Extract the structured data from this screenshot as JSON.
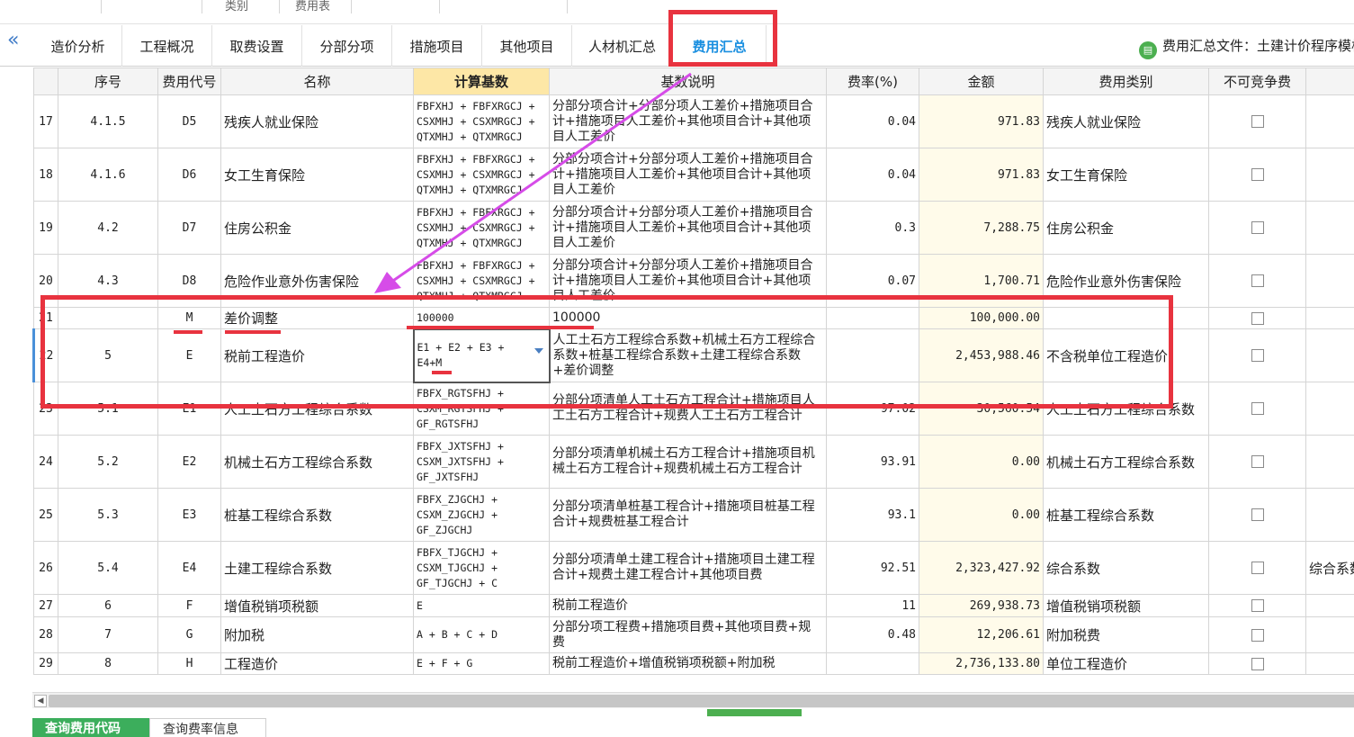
{
  "top_strip": {
    "labels": [
      "类别",
      "费用表"
    ]
  },
  "tabs": [
    {
      "label": "造价分析"
    },
    {
      "label": "工程概况"
    },
    {
      "label": "取费设置"
    },
    {
      "label": "分部分项"
    },
    {
      "label": "措施项目"
    },
    {
      "label": "其他项目"
    },
    {
      "label": "人材机汇总"
    },
    {
      "label": "费用汇总"
    }
  ],
  "active_tab": "费用汇总",
  "file_info": "费用汇总文件：土建计价程序模板",
  "columns": [
    "",
    "序号",
    "费用代号",
    "名称",
    "计算基数",
    "基数说明",
    "费率(%)",
    "金额",
    "费用类别",
    "不可竞争费",
    ""
  ],
  "rows": [
    {
      "idx": "17",
      "seq": "4.1.5",
      "code": "D5",
      "name": "残疾人就业保险",
      "formula": "FBFXHJ + FBFXRGCJ +\nCSXMHJ + CSXMRGCJ +\nQTXMHJ + QTXMRGCJ",
      "desc": "分部分项合计+分部分项人工差价+措施项目合计+措施项目人工差价+其他项目合计+其他项目人工差价",
      "rate": "0.04",
      "amount": "971.83",
      "category": "残疾人就业保险",
      "extra": ""
    },
    {
      "idx": "18",
      "seq": "4.1.6",
      "code": "D6",
      "name": "女工生育保险",
      "formula": "FBFXHJ + FBFXRGCJ +\nCSXMHJ + CSXMRGCJ +\nQTXMHJ + QTXMRGCJ",
      "desc": "分部分项合计+分部分项人工差价+措施项目合计+措施项目人工差价+其他项目合计+其他项目人工差价",
      "rate": "0.04",
      "amount": "971.83",
      "category": "女工生育保险",
      "extra": ""
    },
    {
      "idx": "19",
      "seq": "4.2",
      "code": "D7",
      "name": "住房公积金",
      "formula": "FBFXHJ + FBFXRGCJ +\nCSXMHJ + CSXMRGCJ +\nQTXMHJ + QTXMRGCJ",
      "desc": "分部分项合计+分部分项人工差价+措施项目合计+措施项目人工差价+其他项目合计+其他项目人工差价",
      "rate": "0.3",
      "amount": "7,288.75",
      "category": "住房公积金",
      "extra": ""
    },
    {
      "idx": "20",
      "seq": "4.3",
      "code": "D8",
      "name": "危险作业意外伤害保险",
      "formula": "FBFXHJ + FBFXRGCJ +\nCSXMHJ + CSXMRGCJ +\nQTXMHJ + QTXMRGCJ",
      "desc": "分部分项合计+分部分项人工差价+措施项目合计+措施项目人工差价+其他项目合计+其他项目人工差价",
      "rate": "0.07",
      "amount": "1,700.71",
      "category": "危险作业意外伤害保险",
      "extra": ""
    },
    {
      "idx": "21",
      "seq": "",
      "code": "M",
      "name": "差价调整",
      "formula": "100000",
      "desc": "100000",
      "rate": "",
      "amount": "100,000.00",
      "category": "",
      "extra": ""
    },
    {
      "idx": "22",
      "seq": "5",
      "code": "E",
      "name": "税前工程造价",
      "formula": "E1 + E2 + E3 +\nE4+M",
      "desc": "人工土石方工程综合系数+机械土石方工程综合系数+桩基工程综合系数+土建工程综合系数+差价调整",
      "rate": "",
      "amount": "2,453,988.46",
      "category": "不含税单位工程造价",
      "extra": ""
    },
    {
      "idx": "23",
      "seq": "5.1",
      "code": "E1",
      "name": "人工土石方工程综合系数",
      "formula": "FBFX_RGTSFHJ +\nCSXM_RGTSFHJ +\nGF_RGTSFHJ",
      "desc": "分部分项清单人工土石方工程合计+措施项目人工土石方工程合计+规费人工土石方工程合计",
      "rate": "97.02",
      "amount": "30,560.54",
      "category": "人工土石方工程综合系数",
      "extra": ""
    },
    {
      "idx": "24",
      "seq": "5.2",
      "code": "E2",
      "name": "机械土石方工程综合系数",
      "formula": "FBFX_JXTSFHJ +\nCSXM_JXTSFHJ +\nGF_JXTSFHJ",
      "desc": "分部分项清单机械土石方工程合计+措施项目机械土石方工程合计+规费机械土石方工程合计",
      "rate": "93.91",
      "amount": "0.00",
      "category": "机械土石方工程综合系数",
      "extra": ""
    },
    {
      "idx": "25",
      "seq": "5.3",
      "code": "E3",
      "name": "桩基工程综合系数",
      "formula": "FBFX_ZJGCHJ +\nCSXM_ZJGCHJ +\nGF_ZJGCHJ",
      "desc": "分部分项清单桩基工程合计+措施项目桩基工程合计+规费桩基工程合计",
      "rate": "93.1",
      "amount": "0.00",
      "category": "桩基工程综合系数",
      "extra": ""
    },
    {
      "idx": "26",
      "seq": "5.4",
      "code": "E4",
      "name": "土建工程综合系数",
      "formula": "FBFX_TJGCHJ +\nCSXM_TJGCHJ +\nGF_TJGCHJ + C",
      "desc": "分部分项清单土建工程合计+措施项目土建工程合计+规费土建工程合计+其他项目费",
      "rate": "92.51",
      "amount": "2,323,427.92",
      "category": "综合系数",
      "extra": "综合系数"
    },
    {
      "idx": "27",
      "seq": "6",
      "code": "F",
      "name": "增值税销项税额",
      "formula": "E",
      "desc": "税前工程造价",
      "rate": "11",
      "amount": "269,938.73",
      "category": "增值税销项税额",
      "extra": ""
    },
    {
      "idx": "28",
      "seq": "7",
      "code": "G",
      "name": "附加税",
      "formula": "A + B + C + D",
      "desc": "分部分项工程费+措施项目费+其他项目费+规费",
      "rate": "0.48",
      "amount": "12,206.61",
      "category": "附加税费",
      "extra": ""
    },
    {
      "idx": "29",
      "seq": "8",
      "code": "H",
      "name": "工程造价",
      "formula": "E + F + G",
      "desc": "税前工程造价+增值税销项税额+附加税",
      "rate": "",
      "amount": "2,736,133.80",
      "category": "单位工程造价",
      "extra": ""
    }
  ],
  "bottom_tabs": [
    {
      "label": "查询费用代码"
    },
    {
      "label": "查询费率信息"
    }
  ],
  "colors": {
    "annotation_red": "#e8333f",
    "active_tab_blue": "#1a8fe0",
    "calc_header": "#fde7a6",
    "bottom_active_green": "#3cae5c"
  }
}
